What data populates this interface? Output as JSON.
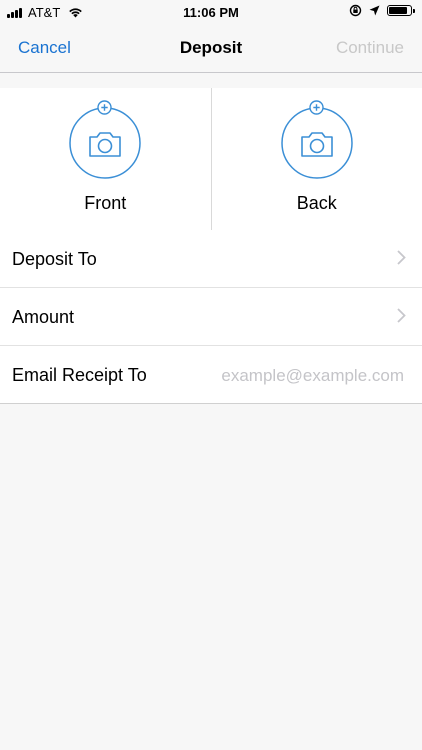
{
  "status_bar": {
    "carrier": "AT&T",
    "time": "11:06 PM"
  },
  "nav": {
    "cancel_label": "Cancel",
    "title": "Deposit",
    "continue_label": "Continue"
  },
  "capture": {
    "front_label": "Front",
    "back_label": "Back"
  },
  "form": {
    "deposit_to_label": "Deposit To",
    "amount_label": "Amount",
    "email_label": "Email Receipt To",
    "email_placeholder": "example@example.com",
    "email_value": ""
  },
  "colors": {
    "accent": "#1a73d1",
    "icon_blue": "#3b8fd6",
    "disabled": "#c8c8c8",
    "placeholder": "#c4c4c8",
    "background": "#f7f7f7"
  },
  "icons": {
    "camera": "camera-icon",
    "plus_badge": "plus-badge-icon",
    "chevron": "chevron-right-icon",
    "wifi": "wifi-icon",
    "signal": "signal-icon",
    "location": "location-arrow-icon",
    "orientation_lock": "orientation-lock-icon",
    "battery": "battery-icon"
  }
}
